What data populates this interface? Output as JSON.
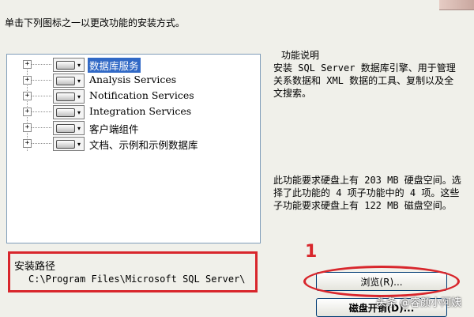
{
  "instruction": "单击下列图标之一以更改功能的安装方式。",
  "tree": {
    "items": [
      {
        "label": "数据库服务",
        "selected": true
      },
      {
        "label": "Analysis Services",
        "selected": false
      },
      {
        "label": "Notification Services",
        "selected": false
      },
      {
        "label": "Integration Services",
        "selected": false
      },
      {
        "label": "客户端组件",
        "selected": false
      },
      {
        "label": "文档、示例和示例数据库",
        "selected": false
      }
    ],
    "expander_symbol": "+",
    "dropdown_caret": "▾"
  },
  "description": {
    "heading": "功能说明",
    "text": "安装 SQL Server 数据库引擎、用于管理关系数据和 XML 数据的工具、复制以及全文搜索。",
    "space_text": "此功能要求硬盘上有 203 MB 硬盘空间。选择了此功能的 4 项子功能中的 4 项。这些子功能要求硬盘上有 122 MB 磁盘空间。"
  },
  "install_path": {
    "label": "安装路径",
    "value": "C:\\Program Files\\Microsoft SQL Server\\"
  },
  "annotation": {
    "step_number": "1",
    "highlight_color": "#d8262c"
  },
  "buttons": {
    "browse": "浏览(R)...",
    "disk_cost": "磁盘开销(D)..."
  },
  "watermark": "头条 @容颜小阿姨",
  "colors": {
    "selection": "#3169c6",
    "dialog_bg": "#f0f0ea"
  }
}
